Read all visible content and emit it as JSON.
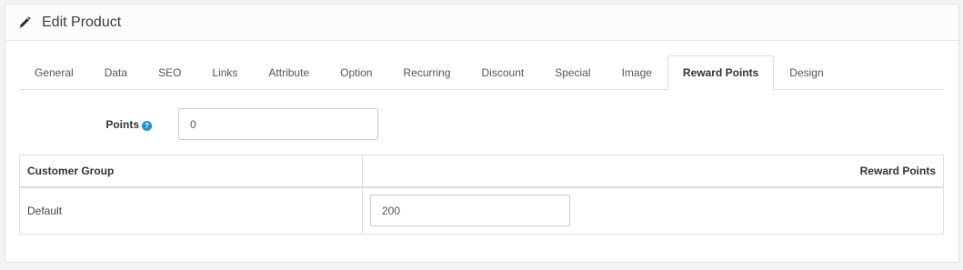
{
  "header": {
    "icon": "pencil-icon",
    "title": "Edit Product"
  },
  "tabs": [
    {
      "label": "General",
      "active": false
    },
    {
      "label": "Data",
      "active": false
    },
    {
      "label": "SEO",
      "active": false
    },
    {
      "label": "Links",
      "active": false
    },
    {
      "label": "Attribute",
      "active": false
    },
    {
      "label": "Option",
      "active": false
    },
    {
      "label": "Recurring",
      "active": false
    },
    {
      "label": "Discount",
      "active": false
    },
    {
      "label": "Special",
      "active": false
    },
    {
      "label": "Image",
      "active": false
    },
    {
      "label": "Reward Points",
      "active": true
    },
    {
      "label": "Design",
      "active": false
    }
  ],
  "points": {
    "label": "Points",
    "help_icon": "question-circle-icon",
    "help_glyph": "?",
    "value": "0"
  },
  "table": {
    "headers": [
      "Customer Group",
      "Reward Points"
    ],
    "rows": [
      {
        "group": "Default",
        "points": "200"
      }
    ]
  },
  "colors": {
    "help_icon": "#1e91cf",
    "border": "#dddddd"
  }
}
